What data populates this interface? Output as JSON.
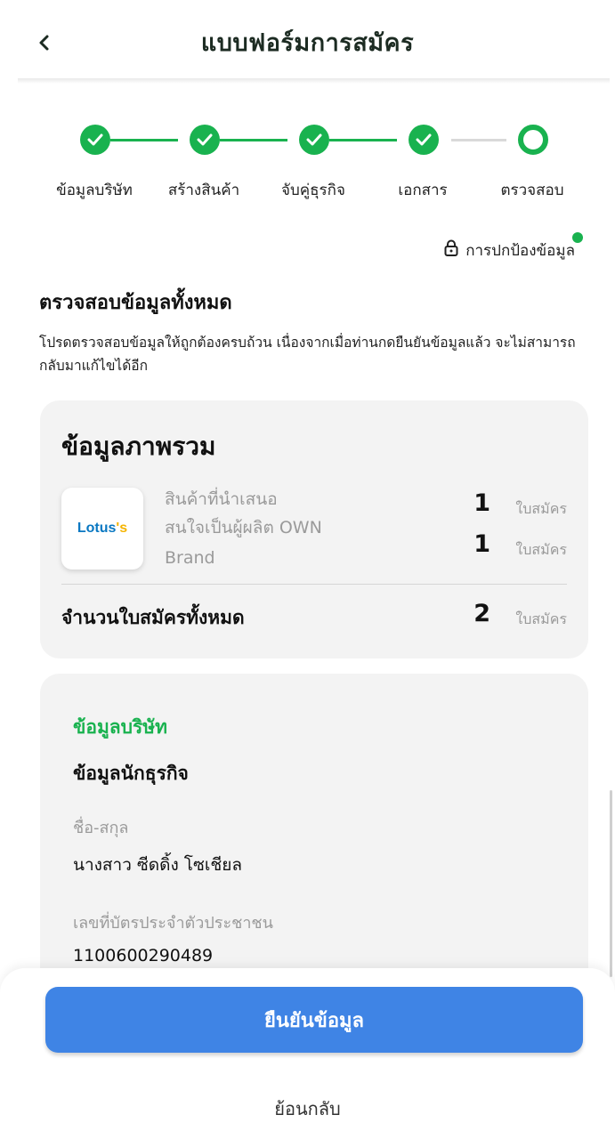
{
  "header": {
    "title": "แบบฟอร์มการสมัคร",
    "back_icon": "chevron-left-icon"
  },
  "stepper": {
    "steps": [
      {
        "label": "ข้อมูลบริษัท",
        "status": "done"
      },
      {
        "label": "สร้างสินค้า",
        "status": "done"
      },
      {
        "label": "จับคู่ธุรกิจ",
        "status": "done"
      },
      {
        "label": "เอกสาร",
        "status": "done"
      },
      {
        "label": "ตรวจสอบ",
        "status": "current"
      }
    ],
    "active_color": "#19b24f",
    "inactive_color": "#d9d9d9"
  },
  "protection": {
    "label": "การปกป้องข้อมูล",
    "icon": "lock-icon"
  },
  "review": {
    "title": "ตรวจสอบข้อมูลทั้งหมด",
    "description": "โปรดตรวจสอบข้อมูลให้ถูกต้องครบถ้วน เนื่องจากเมื่อท่านกดยืนยันข้อมูลแล้ว จะไม่สามารถกลับมาแก้ไขได้อีก"
  },
  "overview": {
    "title": "ข้อมูลภาพรวม",
    "logo_text": "Lotus",
    "logo_accent": "'s",
    "rows": [
      {
        "label": "สินค้าที่นำเสนอ",
        "count": "1",
        "unit": "ใบสมัคร"
      },
      {
        "label_line1": "สนใจเป็นผู้ผลิต OWN",
        "label_line2": "Brand",
        "count": "1",
        "unit": "ใบสมัคร"
      }
    ],
    "total_label": "จำนวนใบสมัครทั้งหมด",
    "total_count": "2",
    "total_unit": "ใบสมัคร"
  },
  "company": {
    "heading": "ข้อมูลบริษัท",
    "subheading": "ข้อมูลนักธุรกิจ",
    "fields": [
      {
        "label": "ชื่อ-สกุล",
        "value": "นางสาว ซีดดิ้ง โซเชียล"
      },
      {
        "label": "เลขที่บัตรประจำตัวประชาชน",
        "value": "1100600290489"
      }
    ]
  },
  "footer": {
    "confirm_label": "ยืนยันข้อมูล",
    "back_label": "ย้อนกลับ",
    "confirm_color": "#3f84e5"
  }
}
